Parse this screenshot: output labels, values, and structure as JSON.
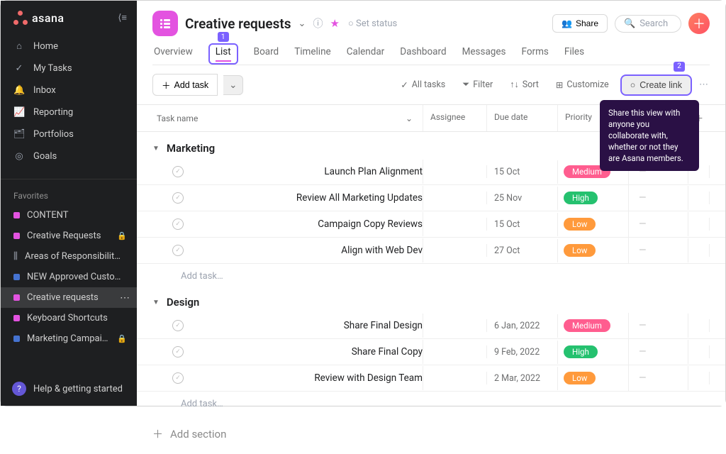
{
  "brand": "asana",
  "sidebar": {
    "nav": [
      {
        "icon": "⌂",
        "label": "Home"
      },
      {
        "icon": "✓",
        "label": "My Tasks"
      },
      {
        "icon": "🔔",
        "label": "Inbox"
      },
      {
        "icon": "📈",
        "label": "Reporting"
      },
      {
        "icon": "🗂",
        "label": "Portfolios"
      },
      {
        "icon": "◎",
        "label": "Goals"
      }
    ],
    "favorites_label": "Favorites",
    "favorites": [
      {
        "color": "#e353e0",
        "label": "CONTENT",
        "lock": false
      },
      {
        "color": "#e353e0",
        "label": "Creative Requests",
        "lock": true
      },
      {
        "bars": true,
        "label": "Areas of Responsibilit…",
        "lock": false
      },
      {
        "color": "#4573d1",
        "label": "NEW Approved Custo…",
        "lock": false
      },
      {
        "color": "#e353e0",
        "label": "Creative requests",
        "lock": false,
        "active": true,
        "more": true
      },
      {
        "color": "#e353e0",
        "label": "Keyboard Shortcuts",
        "lock": false
      },
      {
        "color": "#4573d1",
        "label": "Marketing Campai…",
        "lock": true
      }
    ],
    "help": "Help & getting started"
  },
  "header": {
    "title": "Creative requests",
    "set_status": "Set status",
    "share": "Share",
    "search_placeholder": "Search"
  },
  "tabs": [
    "Overview",
    "List",
    "Board",
    "Timeline",
    "Calendar",
    "Dashboard",
    "Messages",
    "Forms",
    "Files"
  ],
  "callouts": {
    "tab": "1",
    "create": "2"
  },
  "toolbar": {
    "add_task": "Add task",
    "all_tasks": "All tasks",
    "filter": "Filter",
    "sort": "Sort",
    "customize": "Customize",
    "create_link": "Create link",
    "tooltip": "Share this view with anyone you collaborate with, whether or not they are Asana members."
  },
  "columns": {
    "name": "Task name",
    "assignee": "Assignee",
    "due": "Due date",
    "priority": "Priority"
  },
  "sections": [
    {
      "name": "Marketing",
      "tasks": [
        {
          "title": "Launch Plan Alignment",
          "due": "15 Oct",
          "priority": "Medium"
        },
        {
          "title": "Review All Marketing Updates",
          "due": "25 Nov",
          "priority": "High"
        },
        {
          "title": "Campaign Copy Reviews",
          "due": "15 Oct",
          "priority": "Low"
        },
        {
          "title": "Align with Web Dev",
          "due": "27 Oct",
          "priority": "Low"
        }
      ],
      "add": "Add task…"
    },
    {
      "name": "Design",
      "tasks": [
        {
          "title": "Share Final Design",
          "due": "6 Jan, 2022",
          "priority": "Medium"
        },
        {
          "title": "Share Final Copy",
          "due": "9 Feb, 2022",
          "priority": "High"
        },
        {
          "title": "Review with Design Team",
          "due": "2 Mar, 2022",
          "priority": "Low"
        }
      ],
      "add": "Add task…"
    }
  ],
  "add_section": "Add section"
}
